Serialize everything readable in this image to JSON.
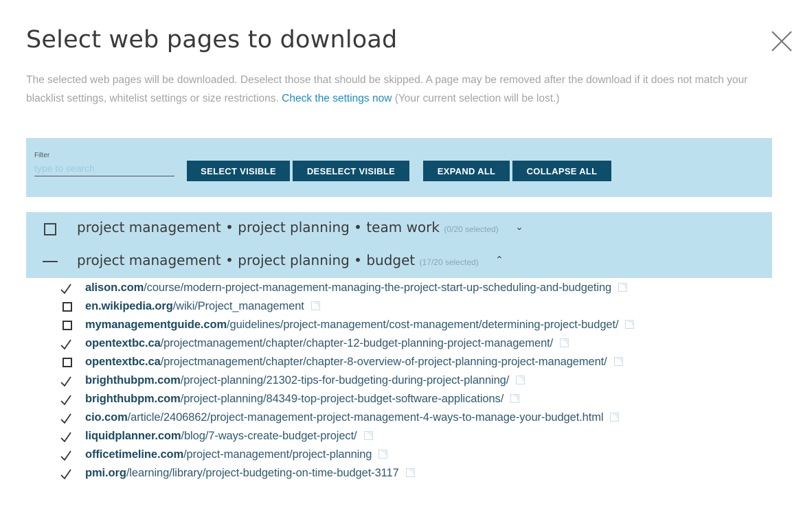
{
  "dialog": {
    "title": "Select web pages to download",
    "description_pre": "The selected web pages will be downloaded. Deselect those that should be skipped. A page may be removed after the download if it does not match your blacklist settings, whitelist settings or size restrictions. ",
    "settings_link": "Check the settings now",
    "description_post": " (Your current selection will be lost.)"
  },
  "toolbar": {
    "filter_label": "Filter",
    "filter_placeholder": "type to search",
    "filter_value": "",
    "select_visible": "SELECT VISIBLE",
    "deselect_visible": "DESELECT VISIBLE",
    "expand_all": "EXPAND ALL",
    "collapse_all": "COLLAPSE ALL"
  },
  "groups": [
    {
      "label": "project management • project planning • team work",
      "count": "(0/20 selected)",
      "state": "unchecked",
      "expanded": false
    },
    {
      "label": "project management • project planning • budget",
      "count": "(17/20 selected)",
      "state": "partial",
      "expanded": true
    }
  ],
  "items": [
    {
      "domain": "alison.com",
      "path": "/course/modern-project-management-managing-the-project-start-up-scheduling-and-budgeting",
      "checked": true
    },
    {
      "domain": "en.wikipedia.org",
      "path": "/wiki/Project_management",
      "checked": false
    },
    {
      "domain": "mymanagementguide.com",
      "path": "/guidelines/project-management/cost-management/determining-project-budget/",
      "checked": false
    },
    {
      "domain": "opentextbc.ca",
      "path": "/projectmanagement/chapter/chapter-12-budget-planning-project-management/",
      "checked": true
    },
    {
      "domain": "opentextbc.ca",
      "path": "/projectmanagement/chapter/chapter-8-overview-of-project-planning-project-management/",
      "checked": false
    },
    {
      "domain": "brighthubpm.com",
      "path": "/project-planning/21302-tips-for-budgeting-during-project-planning/",
      "checked": true
    },
    {
      "domain": "brighthubpm.com",
      "path": "/project-planning/84349-top-project-budget-software-applications/",
      "checked": true
    },
    {
      "domain": "cio.com",
      "path": "/article/2406862/project-management-project-management-4-ways-to-manage-your-budget.html",
      "checked": true
    },
    {
      "domain": "liquidplanner.com",
      "path": "/blog/7-ways-create-budget-project/",
      "checked": true
    },
    {
      "domain": "officetimeline.com",
      "path": "/project-management/project-planning",
      "checked": true
    },
    {
      "domain": "pmi.org",
      "path": "/learning/library/project-budgeting-on-time-budget-3117",
      "checked": true
    }
  ],
  "colors": {
    "accent": "#0e4e6b",
    "panel": "#bde0ee",
    "link": "#1a8cc8"
  }
}
